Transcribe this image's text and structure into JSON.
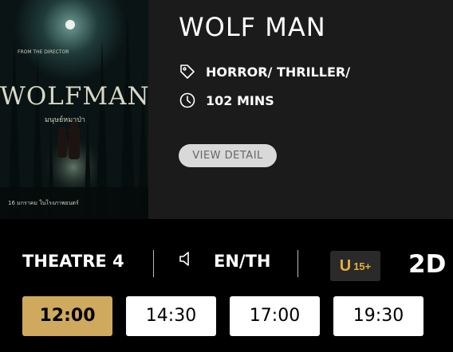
{
  "movie": {
    "title": "WOLF MAN",
    "genres": "HORROR/ THRILLER/",
    "duration": "102 MINS",
    "detail_button": "VIEW DETAIL"
  },
  "poster": {
    "title_art": "WOLFMAN",
    "thai_subtitle": "มนุษย์หมาป่า",
    "release_line": "16 มกราคม ในโรงภาพยนตร์"
  },
  "showtimes": {
    "theatre": "THEATRE 4",
    "audio_language": "EN/TH",
    "rating": {
      "prefix": "U",
      "age": "15+"
    },
    "format": "2D",
    "times": [
      {
        "label": "12:00",
        "selected": true
      },
      {
        "label": "14:30",
        "selected": false
      },
      {
        "label": "17:00",
        "selected": false
      },
      {
        "label": "19:30",
        "selected": false
      }
    ]
  },
  "colors": {
    "selected_time": "#cfa95e",
    "rating_text": "#e3b03f",
    "card_background": "#1b1b1b"
  }
}
